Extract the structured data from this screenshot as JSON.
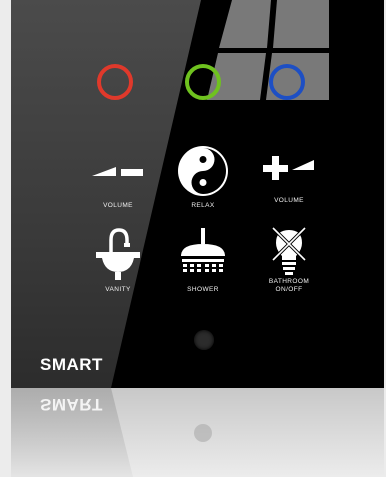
{
  "panel": {
    "brand": "SMART",
    "indicators": [
      {
        "name": "red-indicator",
        "color": "#e0392b"
      },
      {
        "name": "green-indicator",
        "color": "#6fc21f"
      },
      {
        "name": "blue-indicator",
        "color": "#1d4fc4"
      }
    ],
    "buttons": {
      "volume_down": {
        "label": "VOLUME",
        "icon": "volume-down-icon"
      },
      "relax": {
        "label": "RELAX",
        "icon": "yin-yang-icon"
      },
      "volume_up": {
        "label": "VOLUME",
        "icon": "volume-up-icon"
      },
      "vanity": {
        "label": "VANITY",
        "icon": "sink-faucet-icon"
      },
      "shower": {
        "label": "SHOWER",
        "icon": "shower-head-icon"
      },
      "bathroom": {
        "label_line1": "BATHROOM",
        "label_line2": "ON/OFF",
        "icon": "crossed-lightbulb-icon"
      }
    }
  }
}
